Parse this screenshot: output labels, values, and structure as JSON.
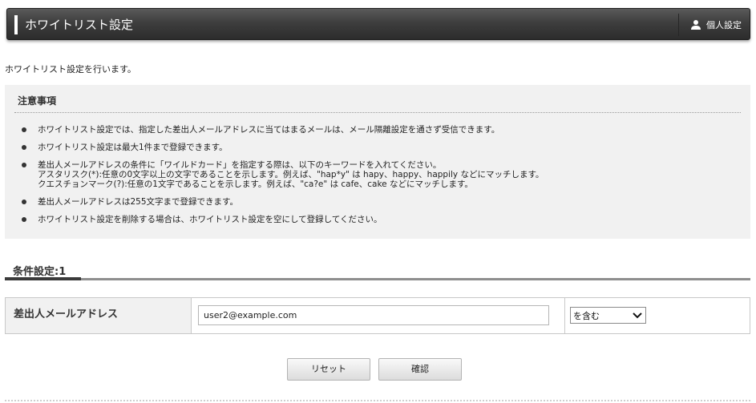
{
  "header": {
    "title": "ホワイトリスト設定",
    "personal_label": "個人設定"
  },
  "intro": "ホワイトリスト設定を行います。",
  "notice": {
    "title": "注意事項",
    "items": [
      {
        "lines": [
          "ホワイトリスト設定では、指定した差出人メールアドレスに当てはまるメールは、メール隔離設定を通さず受信できます。"
        ]
      },
      {
        "lines": [
          "ホワイトリスト設定は最大1件まで登録できます。"
        ]
      },
      {
        "lines": [
          "差出人メールアドレスの条件に「ワイルドカード」を指定する際は、以下のキーワードを入れてください。",
          "アスタリスク(*):任意の0文字以上の文字であることを示します。例えば、\"hap*y\" は hapy、happy、happily などにマッチします。",
          "クエスチョンマーク(?):任意の1文字であることを示します。例えば、\"ca?e\" は cafe、cake などにマッチします。"
        ]
      },
      {
        "lines": [
          "差出人メールアドレスは255文字まで登録できます。"
        ]
      },
      {
        "lines": [
          "ホワイトリスト設定を削除する場合は、ホワイトリスト設定を空にして登録してください。"
        ]
      }
    ]
  },
  "section": {
    "title": "条件設定:1"
  },
  "form": {
    "label": "差出人メールアドレス",
    "email_value": "user2@example.com",
    "match_selected": "を含む"
  },
  "buttons": {
    "reset": "リセット",
    "confirm": "確認"
  }
}
